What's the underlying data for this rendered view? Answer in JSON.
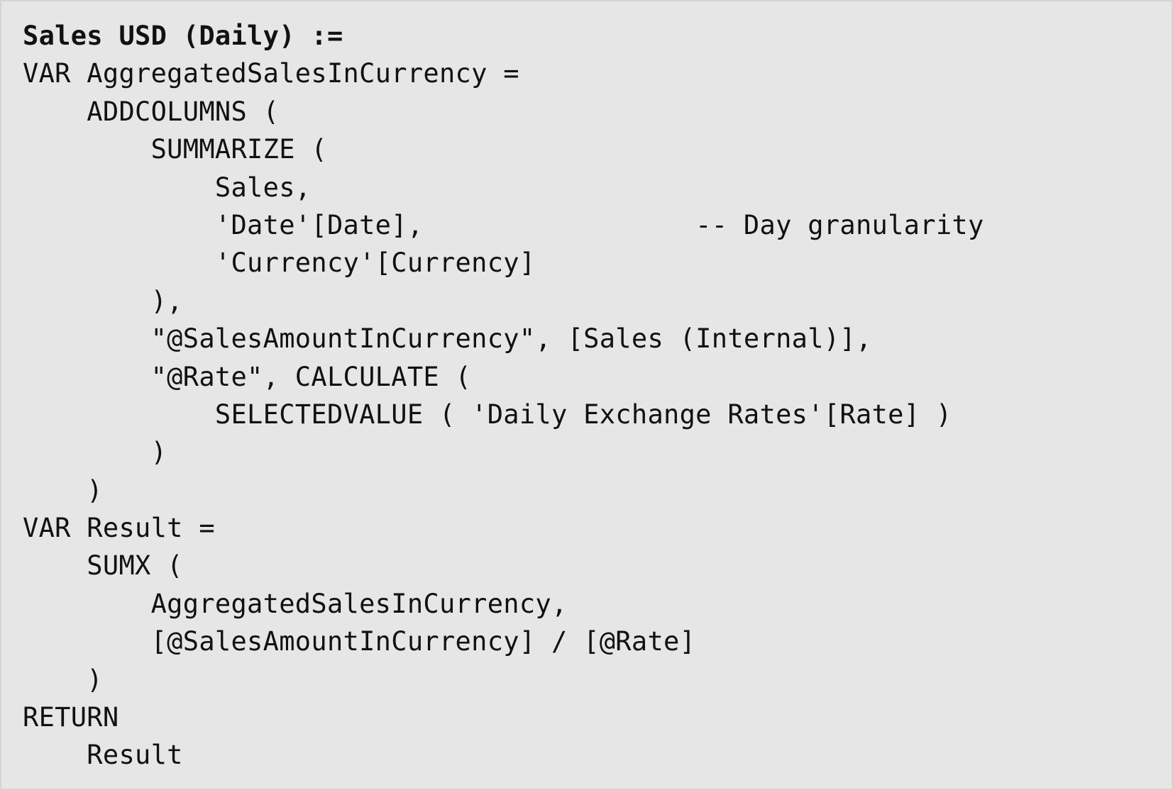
{
  "code": {
    "lines": [
      "Sales USD (Daily) :=",
      "VAR AggregatedSalesInCurrency =",
      "    ADDCOLUMNS (",
      "        SUMMARIZE (",
      "            Sales,",
      "            'Date'[Date],                 -- Day granularity",
      "            'Currency'[Currency]",
      "        ),",
      "        \"@SalesAmountInCurrency\", [Sales (Internal)],",
      "        \"@Rate\", CALCULATE (",
      "            SELECTEDVALUE ( 'Daily Exchange Rates'[Rate] )",
      "        )",
      "    )",
      "VAR Result =",
      "    SUMX (",
      "        AggregatedSalesInCurrency,",
      "        [@SalesAmountInCurrency] / [@Rate]",
      "    )",
      "RETURN",
      "    Result"
    ]
  }
}
